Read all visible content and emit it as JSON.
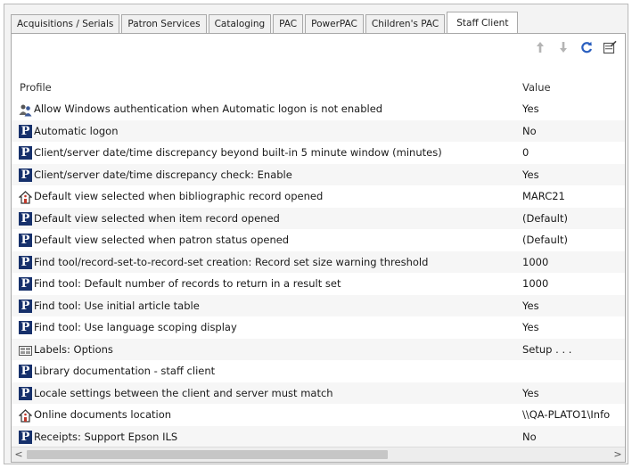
{
  "tabs": [
    {
      "label": "Acquisitions / Serials",
      "active": false
    },
    {
      "label": "Patron Services",
      "active": false
    },
    {
      "label": "Cataloging",
      "active": false
    },
    {
      "label": "PAC",
      "active": false
    },
    {
      "label": "PowerPAC",
      "active": false
    },
    {
      "label": "Children's PAC",
      "active": false
    },
    {
      "label": "Staff Client",
      "active": true
    }
  ],
  "toolbar": {
    "icons": [
      "arrow-up-icon",
      "arrow-down-icon",
      "refresh-icon",
      "edit-properties-icon"
    ]
  },
  "table": {
    "header_profile": "Profile",
    "header_value": "Value",
    "rows": [
      {
        "icon": "users-icon",
        "label": "Allow Windows authentication when Automatic logon is not enabled",
        "value": "Yes"
      },
      {
        "icon": "p-icon",
        "label": "Automatic logon",
        "value": "No"
      },
      {
        "icon": "p-icon",
        "label": "Client/server date/time discrepancy beyond built-in 5 minute window (minutes)",
        "value": "0"
      },
      {
        "icon": "p-icon",
        "label": "Client/server date/time discrepancy check: Enable",
        "value": "Yes"
      },
      {
        "icon": "home-icon",
        "label": "Default view selected when bibliographic record opened",
        "value": "MARC21"
      },
      {
        "icon": "p-icon",
        "label": "Default view selected when item record opened",
        "value": "(Default)"
      },
      {
        "icon": "p-icon",
        "label": "Default view selected when patron status opened",
        "value": "(Default)"
      },
      {
        "icon": "p-icon",
        "label": "Find tool/record-set-to-record-set creation: Record set size warning threshold",
        "value": "1000"
      },
      {
        "icon": "p-icon",
        "label": "Find tool: Default number of records to return in a result set",
        "value": "1000"
      },
      {
        "icon": "p-icon",
        "label": "Find tool: Use initial article table",
        "value": "Yes"
      },
      {
        "icon": "p-icon",
        "label": "Find tool: Use language scoping display",
        "value": "Yes"
      },
      {
        "icon": "labels-icon",
        "label": "Labels: Options",
        "value": "Setup . . ."
      },
      {
        "icon": "p-icon",
        "label": "Library documentation - staff client",
        "value": ""
      },
      {
        "icon": "p-icon",
        "label": "Locale settings between the client and server must match",
        "value": "Yes"
      },
      {
        "icon": "home-icon",
        "label": "Online documents location",
        "value": "\\\\QA-PLATO1\\Info"
      },
      {
        "icon": "p-icon",
        "label": "Receipts: Support Epson ILS",
        "value": "No"
      }
    ]
  },
  "scrollbar": {
    "left_arrow": "<",
    "right_arrow": ">"
  }
}
